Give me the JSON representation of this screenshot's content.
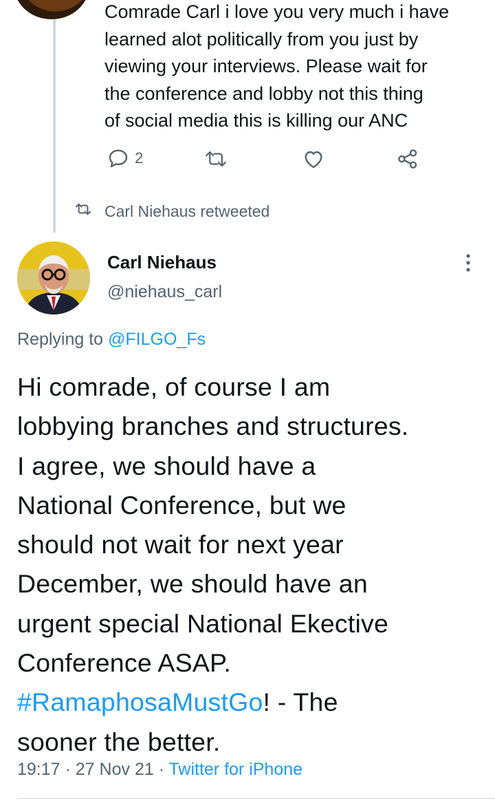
{
  "previous_tweet": {
    "text": "Comrade Carl i love you very much i have\nlearned alot politically from you just by\nviewing your interviews.  Please wait for\nthe conference and lobby not this thing\nof social media this is killing our ANC",
    "reply_count": "2",
    "icons": [
      "reply-icon",
      "retweet-icon",
      "like-icon",
      "share-icon"
    ]
  },
  "retweet_notice": {
    "label": "Carl Niehaus retweeted",
    "icon": "retweet-icon"
  },
  "tweet": {
    "author_name": "Carl Niehaus",
    "author_handle": "@niehaus_carl",
    "replying_prefix": "Replying to ",
    "replying_to": "@FILGO_Fs",
    "text_before_hashtag": "Hi comrade, of course I am\nlobbying branches and structures.\nI agree, we should have a\nNational Conference,  but we\nshould not wait for next year\nDecember, we should have an\nurgent special National Ekective\nConference ASAP.\n",
    "hashtag": "#RamaphosaMustGo",
    "text_after_hashtag": "! -  The\nsooner the better.",
    "time": "19:17",
    "date": "27 Nov 21",
    "separator": " · ",
    "source": "Twitter for iPhone"
  },
  "colors": {
    "link": "#1d9bf0",
    "secondary_text": "#536471",
    "thread_line": "#cfd9de"
  }
}
